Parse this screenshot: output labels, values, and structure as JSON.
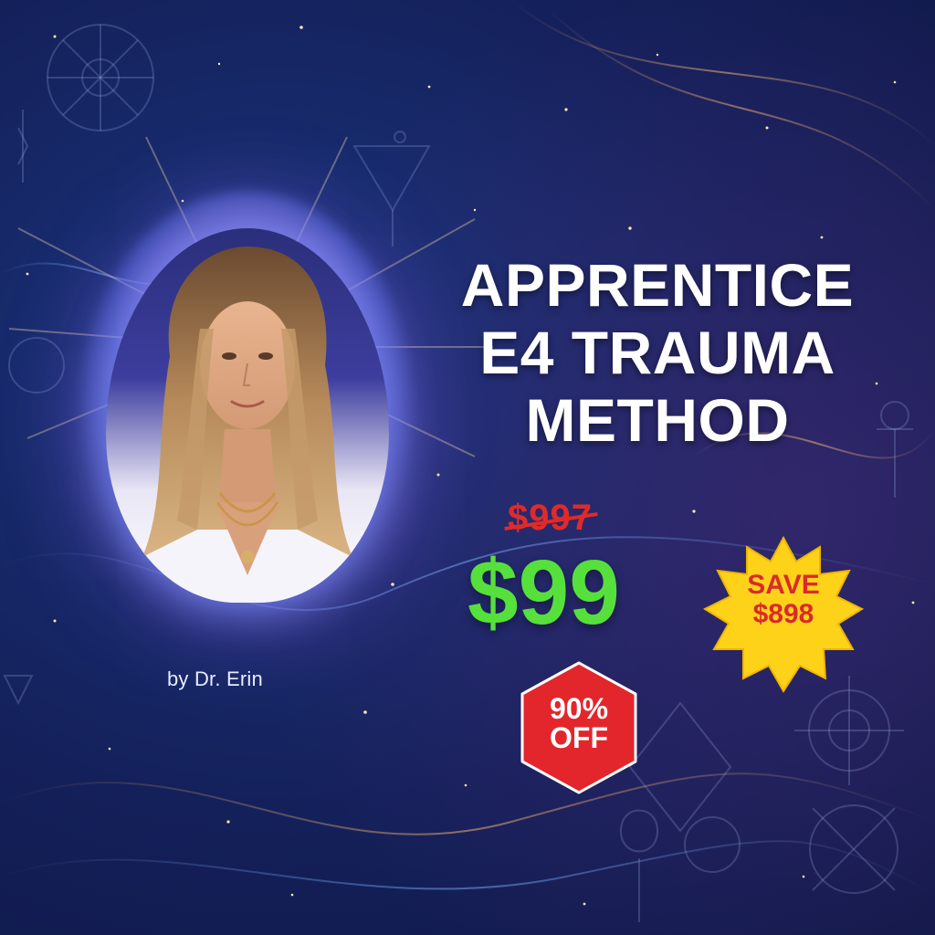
{
  "title": {
    "line1": "APPRENTICE",
    "line2": "E4 TRAUMA",
    "line3": "METHOD"
  },
  "author": "by Dr. Erin",
  "pricing": {
    "original_price": "$997",
    "sale_price": "$99"
  },
  "save_badge": {
    "line1": "SAVE",
    "line2": "$898"
  },
  "discount_badge": {
    "line1": "90%",
    "line2": "OFF"
  },
  "colors": {
    "background": "#14205a",
    "title": "#ffffff",
    "old_price": "#e02a2a",
    "sale_price": "#56e03c",
    "save_badge_fill": "#ffd21a",
    "save_badge_text": "#d92a2a",
    "discount_badge_fill": "#e3262b"
  },
  "icons": {
    "decor": [
      "sacred-geometry-icon",
      "starfield-icon",
      "light-rays-icon"
    ]
  }
}
